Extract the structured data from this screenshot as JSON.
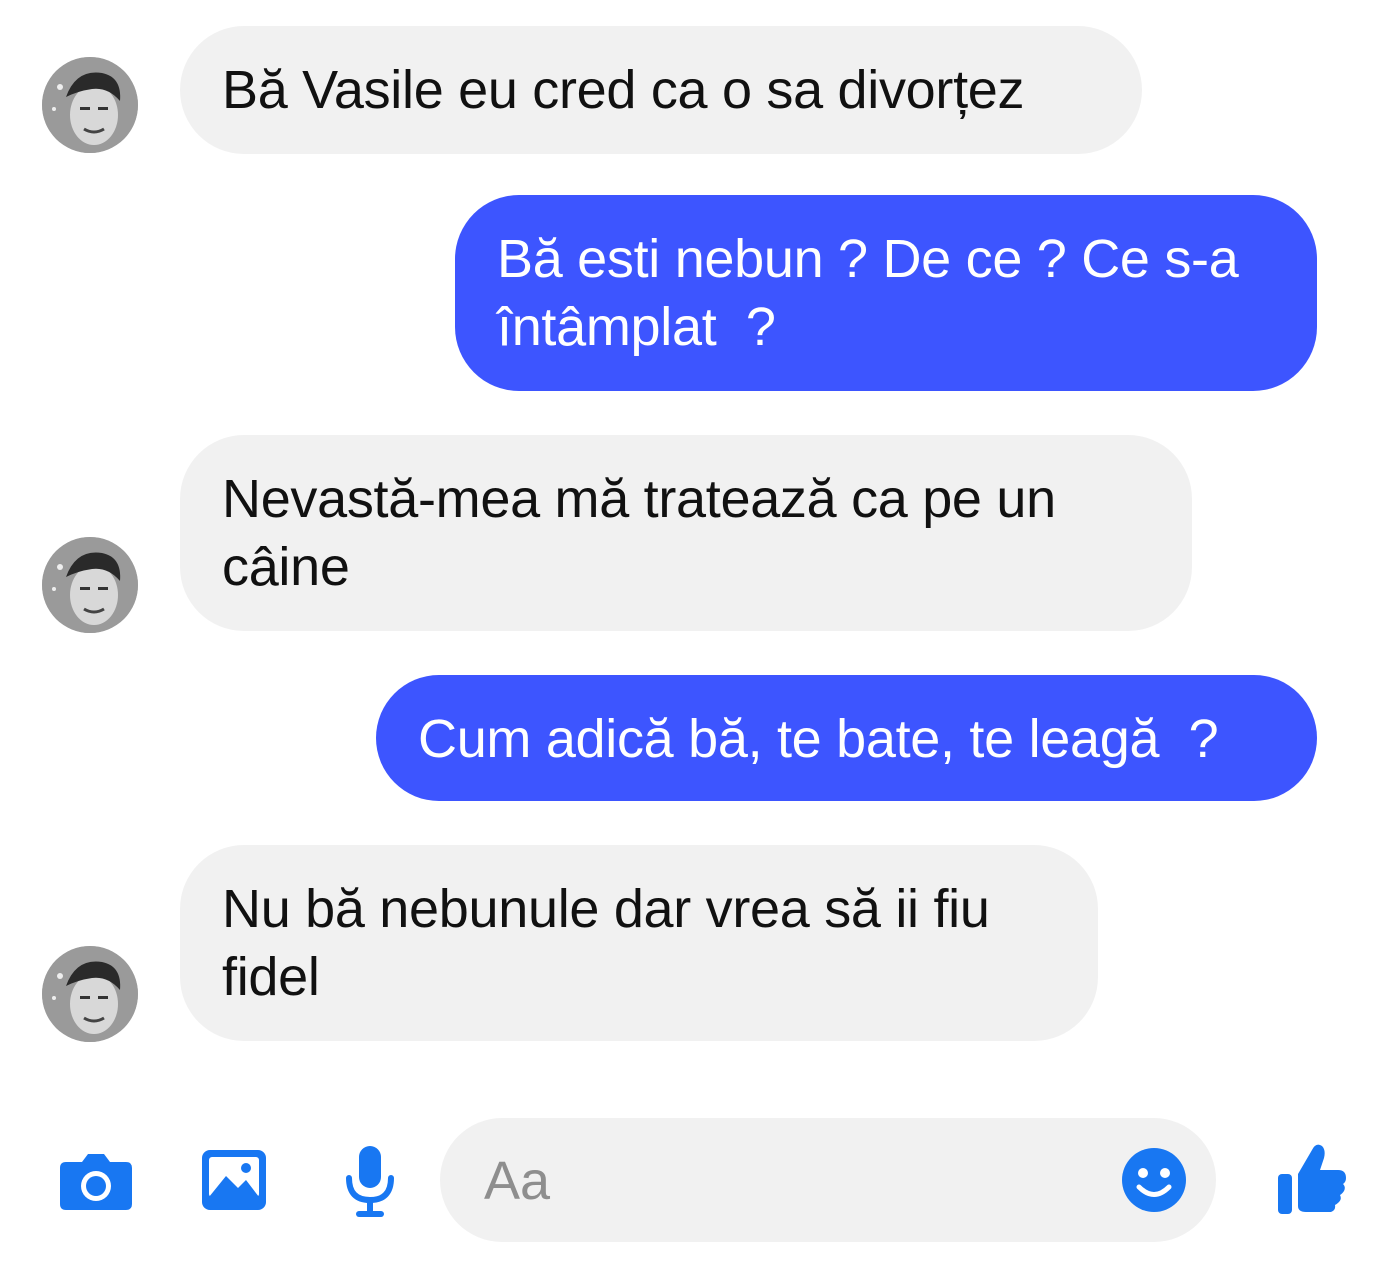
{
  "messages": [
    {
      "direction": "incoming",
      "text": "Bă Vasile eu cred ca o sa divorțez"
    },
    {
      "direction": "outgoing",
      "text": "Bă esti nebun ? De ce ? Ce s-a\nîntâmplat  ?"
    },
    {
      "direction": "incoming",
      "text": "Nevastă-mea mă tratează ca pe un\ncâine"
    },
    {
      "direction": "outgoing",
      "text": "Cum adică bă, te bate, te leagă  ?"
    },
    {
      "direction": "incoming",
      "text": "Nu bă nebunule dar vrea să ii fiu\nfidel"
    }
  ],
  "composer": {
    "placeholder": "Aa",
    "icons": [
      "camera-icon",
      "image-icon",
      "microphone-icon",
      "emoji-icon",
      "thumbs-up-icon"
    ]
  },
  "colors": {
    "accent": "#1877f2",
    "outgoing_bubble": "#3d55ff",
    "incoming_bubble": "#f1f1f1"
  }
}
